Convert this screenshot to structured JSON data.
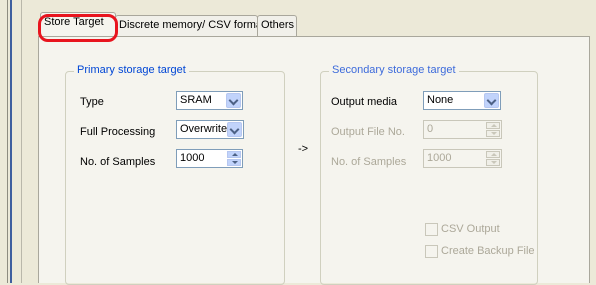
{
  "tabs": [
    {
      "label": "Store Target"
    },
    {
      "label": "Discrete memory/ CSV format"
    },
    {
      "label": "Others"
    }
  ],
  "primary": {
    "title": "Primary storage target",
    "type_label": "Type",
    "type_value": "SRAM",
    "full_label": "Full Processing",
    "full_value": "Overwrite",
    "samples_label": "No. of Samples",
    "samples_value": "1000"
  },
  "arrow": "->",
  "secondary": {
    "title": "Secondary storage target",
    "media_label": "Output media",
    "media_value": "None",
    "fileno_label": "Output File No.",
    "fileno_value": "0",
    "samples_label": "No. of Samples",
    "samples_value": "1000",
    "csv_label": "CSV Output",
    "backup_label": "Create Backup File"
  },
  "colors": {
    "highlight": "#e8141e",
    "group_title": "#0046d5"
  }
}
